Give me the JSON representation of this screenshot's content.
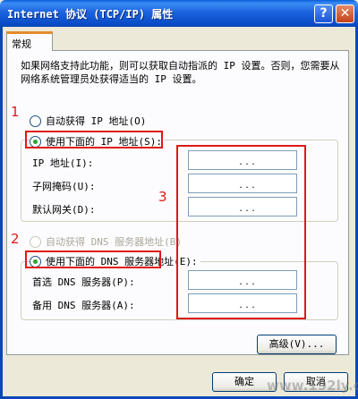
{
  "window": {
    "title": "Internet 协议 (TCP/IP) 属性",
    "help_glyph": "?",
    "close_glyph": "✕"
  },
  "tab": {
    "label": "常规"
  },
  "description": "如果网络支持此功能，则可以获取自动指派的 IP 设置。否则，您需要从网络系统管理员处获得适当的 IP 设置。",
  "ip_section": {
    "auto_option": {
      "label": "自动获得 IP 地址(O)",
      "selected": false
    },
    "manual_option": {
      "label": "使用下面的 IP 地址(S):",
      "selected": true
    },
    "fields": [
      {
        "label": "IP 地址(I):",
        "value": ". . ."
      },
      {
        "label": "子网掩码(U):",
        "value": ". . ."
      },
      {
        "label": "默认网关(D):",
        "value": ". . ."
      }
    ]
  },
  "dns_section": {
    "auto_option": {
      "label": "自动获得 DNS 服务器地址(B)",
      "selected": false,
      "disabled": true
    },
    "manual_option": {
      "label": "使用下面的 DNS 服务器地址(E):",
      "selected": true
    },
    "fields": [
      {
        "label": "首选 DNS 服务器(P):",
        "value": ". . ."
      },
      {
        "label": "备用 DNS 服务器(A):",
        "value": ". . ."
      }
    ]
  },
  "annotations": {
    "one": "1",
    "two": "2",
    "three": "3",
    "color": "#e01818"
  },
  "buttons": {
    "advanced": "高级(V)...",
    "ok": "确定",
    "cancel": "取消"
  },
  "watermark": "www.192ly.com"
}
